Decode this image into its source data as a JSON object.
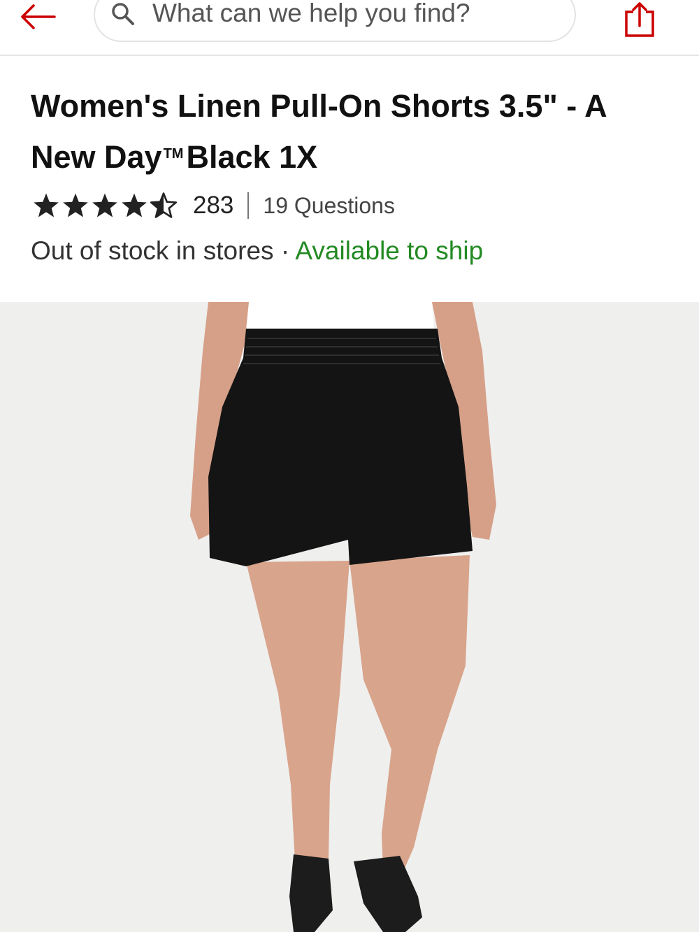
{
  "header": {
    "search": {
      "placeholder": "What can we help you find?",
      "value": ""
    },
    "icons": {
      "back": "arrow-left-icon",
      "search": "magnifier-icon",
      "share": "share-icon"
    }
  },
  "product": {
    "title_main": "Women's Linen Pull-On Shorts 3.5\" - A New Day",
    "trademark": "TM",
    "title_tail": "Black 1X",
    "rating": {
      "stars": 4.5,
      "max": 5,
      "count": "283"
    },
    "questions": "19 Questions",
    "stock": {
      "stores": "Out of stock in stores",
      "separator": "·",
      "ship": "Available to ship"
    }
  },
  "colors": {
    "accent": "#cc0000",
    "available": "#238a23",
    "image_bg": "#efefee"
  }
}
